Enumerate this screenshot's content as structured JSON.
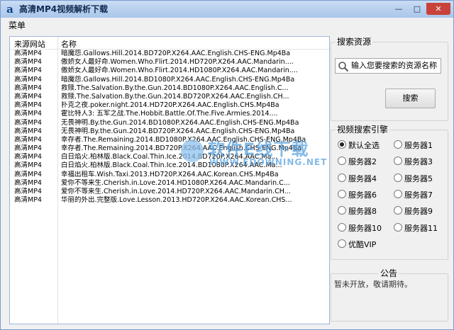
{
  "window": {
    "title": "高清MP4视频解析下载",
    "icon_glyph": "a",
    "minimize_glyph": "—",
    "maximize_glyph": "□",
    "close_glyph": "✕"
  },
  "menu": {
    "label": "菜单"
  },
  "list": {
    "headers": {
      "source": "来源网站",
      "name": "名称"
    },
    "rows": [
      {
        "source": "高清MP4",
        "name": "暗魔怨.Gallows.Hill.2014.BD720P.X264.AAC.English.CHS-ENG.Mp4Ba"
      },
      {
        "source": "高清MP4",
        "name": "傲娇女人最好命.Women.Who.Flirt.2014.HD720P.X264.AAC.Mandarin...."
      },
      {
        "source": "高清MP4",
        "name": "傲娇女人最好命.Women.Who.Flirt.2014.HD1080P.X264.AAC.Mandarin...."
      },
      {
        "source": "高清MP4",
        "name": "暗魔怨.Gallows.Hill.2014.BD1080P.X264.AAC.English.CHS-ENG.Mp4Ba"
      },
      {
        "source": "高清MP4",
        "name": "救赎.The.Salvation.By.the.Gun.2014.BD1080P.X264.AAC.English.C..."
      },
      {
        "source": "高清MP4",
        "name": "救赎.The.Salvation.By.the.Gun.2014.BD720P.X264.AAC.English.CH..."
      },
      {
        "source": "高清MP4",
        "name": "扑克之夜.poker.night.2014.HD720P.X264.AAC.English.CHS.Mp4Ba"
      },
      {
        "source": "高清MP4",
        "name": "霍比特人3: 五军之战.The.Hobbit.Battle.Of.The.Five.Armies.2014...."
      },
      {
        "source": "高清MP4",
        "name": "无畏神明.By.the.Gun.2014.BD1080P.X264.AAC.English.CHS-ENG.Mp4Ba"
      },
      {
        "source": "高清MP4",
        "name": "无畏神明.By.the.Gun.2014.BD720P.X264.AAC.English.CHS-ENG.Mp4Ba"
      },
      {
        "source": "高清MP4",
        "name": "幸存者.The.Remaining.2014.BD1080P.X264.AAC.English.CHS-ENG.Mp4Ba"
      },
      {
        "source": "高清MP4",
        "name": "幸存者.The.Remaining.2014.BD720P.X264.AAC.English.CHS-ENG.Mp4Ba"
      },
      {
        "source": "高清MP4",
        "name": "白日焰火.柏林版.Black.Coal.Thin.Ice.2014.BD720P.X264.AAC.Ma..."
      },
      {
        "source": "高清MP4",
        "name": "白日焰火.柏林版.Black.Coal.Thin.Ice.2014.BD1080P.X264.AAC.Ma..."
      },
      {
        "source": "高清MP4",
        "name": "幸福出租车.Wish.Taxi.2013.HD720P.X264.AAC.Korean.CHS.Mp4Ba"
      },
      {
        "source": "高清MP4",
        "name": "爱你不等来生.Cherish.in.Love.2014.HD1080P.X264.AAC.Mandarin.C..."
      },
      {
        "source": "高清MP4",
        "name": "爱你不等来生.Cherish.in.Love.2014.HD720P.X264.AAC.Mandarin.CH..."
      },
      {
        "source": "高清MP4",
        "name": "华丽的外出.完整版.Love.Lesson.2013.HD720P.X264.AAC.Korean.CHS..."
      }
    ]
  },
  "watermark": {
    "main": "软件E线下载",
    "sub": "WWW.EDOWNING.NET"
  },
  "search": {
    "group_title": "搜索资源",
    "input_value": "输入您要搜索的资源名称",
    "button_label": "搜索"
  },
  "engines": {
    "group_title": "视频搜索引擎",
    "options": [
      {
        "label": "默认全选",
        "checked": true
      },
      {
        "label": "服务器1",
        "checked": false
      },
      {
        "label": "服务器2",
        "checked": false
      },
      {
        "label": "服务器3",
        "checked": false
      },
      {
        "label": "服务器4",
        "checked": false
      },
      {
        "label": "服务器5",
        "checked": false
      },
      {
        "label": "服务器6",
        "checked": false
      },
      {
        "label": "服务器7",
        "checked": false
      },
      {
        "label": "服务器8",
        "checked": false
      },
      {
        "label": "服务器9",
        "checked": false
      },
      {
        "label": "服务器10",
        "checked": false
      },
      {
        "label": "服务器11",
        "checked": false
      },
      {
        "label": "优酷VIP",
        "checked": false
      }
    ]
  },
  "notice": {
    "group_title": "公告",
    "text": "暂未开放，敬请期待。"
  }
}
